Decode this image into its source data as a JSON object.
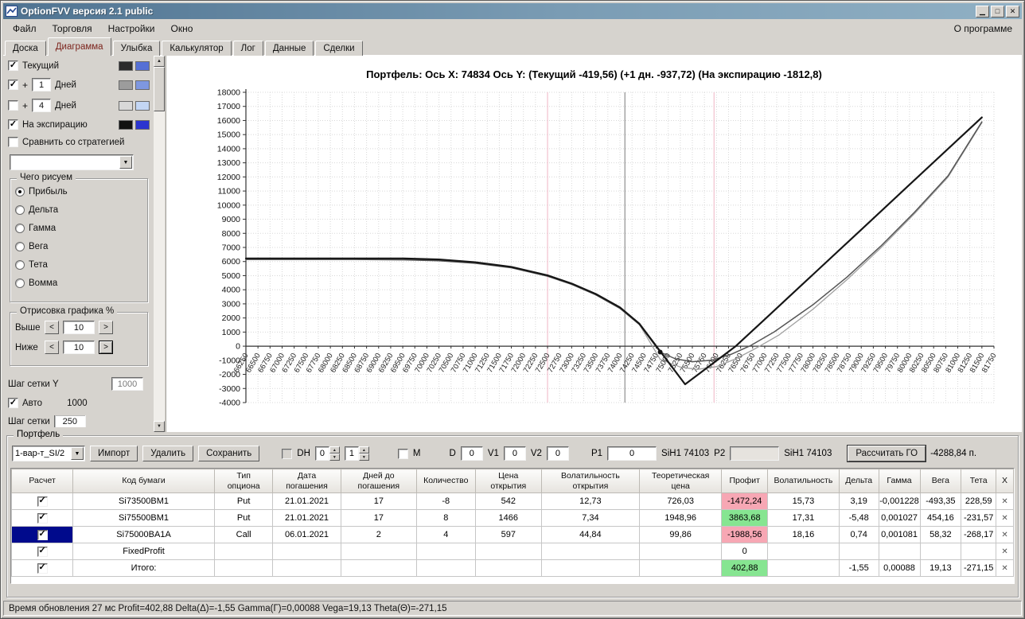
{
  "window": {
    "title": "OptionFVV версия 2.1 public",
    "about_label": "О программе"
  },
  "menu": {
    "items": [
      {
        "id": "file",
        "label": "Файл"
      },
      {
        "id": "trade",
        "label": "Торговля"
      },
      {
        "id": "settings",
        "label": "Настройки"
      },
      {
        "id": "window",
        "label": "Окно"
      }
    ]
  },
  "tabs": [
    {
      "id": "board",
      "label": "Доска",
      "active": false
    },
    {
      "id": "diagram",
      "label": "Диаграмма",
      "active": true
    },
    {
      "id": "smile",
      "label": "Улыбка",
      "active": false
    },
    {
      "id": "calculator",
      "label": "Калькулятор",
      "active": false
    },
    {
      "id": "log",
      "label": "Лог",
      "active": false
    },
    {
      "id": "data",
      "label": "Данные",
      "active": false
    },
    {
      "id": "deals",
      "label": "Сделки",
      "active": false
    }
  ],
  "sidebar": {
    "series_toggles": [
      {
        "id": "current",
        "checked": true,
        "prefix": "",
        "value": null,
        "label": "Текущий",
        "swatches": [
          "#2b2b2b",
          "#5570d6"
        ]
      },
      {
        "id": "plus1",
        "checked": true,
        "prefix": "+",
        "value": "1",
        "label": "Дней",
        "swatches": [
          "#9c9c9c",
          "#7e97e0"
        ]
      },
      {
        "id": "plus4",
        "checked": false,
        "prefix": "+",
        "value": "4",
        "label": "Дней",
        "swatches": [
          "#d8d8d8",
          "#c3d6f4"
        ]
      },
      {
        "id": "expiration",
        "checked": true,
        "prefix": "",
        "value": null,
        "label": "На экспирацию",
        "swatches": [
          "#111111",
          "#2b35cf"
        ]
      }
    ],
    "compare_label": "Сравнить со стратегией",
    "compare_checked": false,
    "strategy_dropdown_value": "",
    "draw_group": {
      "title": "Чего рисуем",
      "selected": "Прибыль",
      "options": [
        "Прибыль",
        "Дельта",
        "Гамма",
        "Вега",
        "Тета",
        "Вомма"
      ]
    },
    "range_group": {
      "title": "Отрисовка графика %",
      "rows": [
        {
          "label": "Выше",
          "value": "10"
        },
        {
          "label": "Ниже",
          "value": "10"
        }
      ]
    },
    "grid_y_label": "Шаг сетки Y",
    "grid_y_value": "1000",
    "auto_label": "Авто",
    "auto_checked": true,
    "auto_value": "1000",
    "grid_x_label": "Шаг сетки",
    "grid_x_value": "250"
  },
  "chart_data": {
    "type": "line",
    "title": "Портфель: Ось X: 74834 Ось Y:  (Текущий -419,56)  (+1 дн. -937,72)  (На экспирацию -1812,8)",
    "x_min": 66250,
    "x_max": 81750,
    "x_tick_step": 250,
    "y_min": -4000,
    "y_max": 18000,
    "y_tick_step": 1000,
    "grid": true,
    "x_axis_at_y": 0,
    "vlines": [
      {
        "x": 72500,
        "color": "#f2c0ce"
      },
      {
        "x": 75950,
        "color": "#f2c0ce"
      },
      {
        "x": 74103,
        "color": "#8f8f8f"
      }
    ],
    "marker": {
      "x": 74834,
      "y": -420
    },
    "series": [
      {
        "name": "+1 дн.",
        "color": "#a0a0a0",
        "width": 1.3,
        "points": [
          [
            66250,
            6180
          ],
          [
            68500,
            6180
          ],
          [
            69500,
            6140
          ],
          [
            70250,
            6070
          ],
          [
            71000,
            5900
          ],
          [
            71750,
            5580
          ],
          [
            72500,
            4980
          ],
          [
            73000,
            4400
          ],
          [
            73500,
            3670
          ],
          [
            74000,
            2710
          ],
          [
            74400,
            1560
          ],
          [
            74834,
            -938
          ],
          [
            75250,
            -1480
          ],
          [
            75600,
            -1650
          ],
          [
            76000,
            -1450
          ],
          [
            76400,
            -900
          ],
          [
            76800,
            -180
          ],
          [
            77300,
            800
          ],
          [
            78000,
            2620
          ],
          [
            78700,
            4700
          ],
          [
            79400,
            6950
          ],
          [
            80100,
            9380
          ],
          [
            80800,
            12000
          ],
          [
            81500,
            15850
          ]
        ]
      },
      {
        "name": "Текущий",
        "color": "#555555",
        "width": 1.5,
        "points": [
          [
            66250,
            6150
          ],
          [
            68500,
            6150
          ],
          [
            69500,
            6120
          ],
          [
            70250,
            6050
          ],
          [
            71000,
            5880
          ],
          [
            71750,
            5560
          ],
          [
            72500,
            4960
          ],
          [
            73000,
            4380
          ],
          [
            73500,
            3640
          ],
          [
            74000,
            2680
          ],
          [
            74400,
            1540
          ],
          [
            74834,
            -420
          ],
          [
            75150,
            -900
          ],
          [
            75500,
            -1100
          ],
          [
            75900,
            -1000
          ],
          [
            76300,
            -580
          ],
          [
            76700,
            30
          ],
          [
            77200,
            1020
          ],
          [
            78000,
            2940
          ],
          [
            78700,
            4880
          ],
          [
            79400,
            7080
          ],
          [
            80100,
            9480
          ],
          [
            80800,
            12080
          ],
          [
            81500,
            15900
          ]
        ]
      },
      {
        "name": "На экспирацию",
        "color": "#161616",
        "width": 2.2,
        "points": [
          [
            66250,
            6220
          ],
          [
            69500,
            6220
          ],
          [
            70250,
            6150
          ],
          [
            71000,
            5950
          ],
          [
            71750,
            5620
          ],
          [
            72500,
            5020
          ],
          [
            73000,
            4440
          ],
          [
            73500,
            3700
          ],
          [
            74000,
            2750
          ],
          [
            74400,
            1600
          ],
          [
            75350,
            -2700
          ],
          [
            76400,
            0
          ],
          [
            77000,
            1900
          ],
          [
            78000,
            5080
          ],
          [
            79000,
            8260
          ],
          [
            80000,
            11450
          ],
          [
            81000,
            14630
          ],
          [
            81500,
            16220
          ]
        ]
      }
    ]
  },
  "portfolio": {
    "group_label": "Портфель",
    "preset_value": "1-вар-т_SI/2",
    "import_label": "Импорт",
    "delete_label": "Удалить",
    "save_label": "Сохранить",
    "dh_label": "DH",
    "dh_checked": false,
    "dh_spin_a": "0",
    "dh_spin_b": "1",
    "m_label": "M",
    "m_checked": false,
    "d_label": "D",
    "d_value": "0",
    "v1_label": "V1",
    "v1_value": "0",
    "v2_label": "V2",
    "v2_value": "0",
    "p1_label": "P1",
    "p1_value": "0",
    "sih1_left": "SiH1 74103",
    "p2_label": "P2",
    "p2_value": "",
    "sih1_right": "SiH1 74103",
    "calc_go_label": "Рассчитать ГО",
    "go_value": "-4288,84 п.",
    "table": {
      "columns": [
        "Расчет",
        "Код бумаги",
        "Тип\nопциона",
        "Дата\nпогашения",
        "Дней до\nпогашения",
        "Количество",
        "Цена\nоткрытия",
        "Волатильность\nоткрытия",
        "Теоретическая\nцена",
        "Профит",
        "Волатильность",
        "Дельта",
        "Гамма",
        "Вега",
        "Тета",
        "X"
      ],
      "rows": [
        {
          "checked": true,
          "selected": false,
          "cells": [
            "Si73500BM1",
            "Put",
            "21.01.2021",
            "17",
            "-8",
            "542",
            "12,73",
            "726,03",
            "-1472,24",
            "15,73",
            "3,19",
            "-0,001228",
            "-493,35",
            "228,59"
          ]
        },
        {
          "checked": true,
          "selected": false,
          "cells": [
            "Si75500BM1",
            "Put",
            "21.01.2021",
            "17",
            "8",
            "1466",
            "7,34",
            "1948,96",
            "3863,68",
            "17,31",
            "-5,48",
            "0,001027",
            "454,16",
            "-231,57"
          ]
        },
        {
          "checked": true,
          "selected": true,
          "cells": [
            "Si75000BA1A",
            "Call",
            "06.01.2021",
            "2",
            "4",
            "597",
            "44,84",
            "99,86",
            "-1988,56",
            "18,16",
            "0,74",
            "0,001081",
            "58,32",
            "-268,17"
          ]
        },
        {
          "checked": true,
          "selected": false,
          "cells": [
            "FixedProfit",
            "",
            "",
            "",
            "",
            "",
            "",
            "",
            "0",
            "",
            "",
            "",
            "",
            ""
          ]
        },
        {
          "checked": true,
          "selected": false,
          "cells": [
            "Итого:",
            "",
            "",
            "",
            "",
            "",
            "",
            "",
            "402,88",
            "",
            "-1,55",
            "0,00088",
            "19,13",
            "-271,15"
          ]
        }
      ]
    }
  },
  "status_bar": {
    "text": "Время обновления 27 мс  Profit=402,88 Delta(Δ)=-1,55 Gamma(Γ)=0,00088 Vega=19,13 Theta(Θ)=-271,15"
  }
}
